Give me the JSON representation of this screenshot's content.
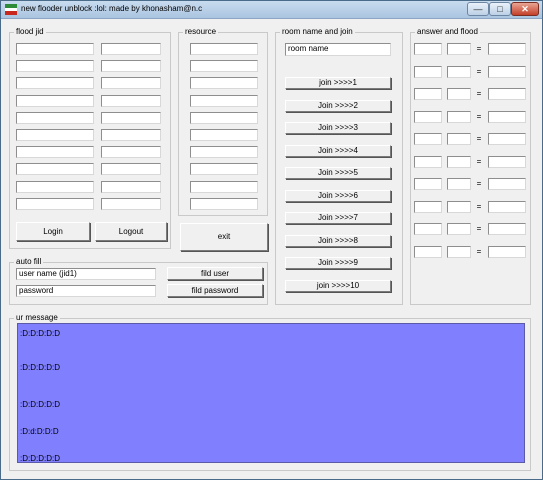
{
  "window": {
    "title": "new flooder unblock :lol: made by khonasham@n.c"
  },
  "flood_jid": {
    "label": "flood jid",
    "left_fields": [
      "",
      "",
      "",
      "",
      "",
      "",
      "",
      "",
      "",
      ""
    ],
    "right_fields": [
      "",
      "",
      "",
      "",
      "",
      "",
      "",
      "",
      "",
      ""
    ],
    "login_label": "Login",
    "logout_label": "Logout"
  },
  "resource": {
    "label": "resource",
    "fields": [
      "",
      "",
      "",
      "",
      "",
      "",
      "",
      "",
      "",
      ""
    ],
    "exit_label": "exit"
  },
  "room": {
    "label": "room name and join",
    "room_value": "room name",
    "join_buttons": [
      "join >>>>1",
      "Join >>>>2",
      "Join >>>>3",
      "Join >>>>4",
      "Join >>>>5",
      "Join >>>>6",
      "Join >>>>7",
      "Join >>>>8",
      "Join >>>>9",
      "join >>>>10"
    ]
  },
  "answer": {
    "label": "answer and flood",
    "rows": [
      {
        "a": "",
        "b": "",
        "eq": "=",
        "result": ""
      },
      {
        "a": "",
        "b": "",
        "eq": "=",
        "result": ""
      },
      {
        "a": "",
        "b": "",
        "eq": "=",
        "result": ""
      },
      {
        "a": "",
        "b": "",
        "eq": "=",
        "result": ""
      },
      {
        "a": "",
        "b": "",
        "eq": "=",
        "result": ""
      },
      {
        "a": "",
        "b": "",
        "eq": "=",
        "result": ""
      },
      {
        "a": "",
        "b": "",
        "eq": "=",
        "result": ""
      },
      {
        "a": "",
        "b": "",
        "eq": "=",
        "result": ""
      },
      {
        "a": "",
        "b": "",
        "eq": "=",
        "result": ""
      },
      {
        "a": "",
        "b": "",
        "eq": "=",
        "result": ""
      }
    ]
  },
  "auto_fill": {
    "label": "auto fill",
    "username_value": "user name (jid1)",
    "password_value": "password",
    "fill_user_label": "fild user",
    "fill_password_label": "fild password"
  },
  "message": {
    "label": "ur message",
    "lines": [
      ":D:D:D:D:D",
      ":D:D:D:D:D",
      ":D:D:D:D:D",
      ":D:d:D:D:D",
      ":D:D:D:D:D"
    ]
  },
  "colors": {
    "message_bg": "#8080ff",
    "window_bg": "#f0f0f0"
  },
  "icons": {
    "app": "app-flag-icon",
    "minimize": "minimize-icon",
    "maximize": "maximize-icon",
    "close": "close-icon"
  }
}
